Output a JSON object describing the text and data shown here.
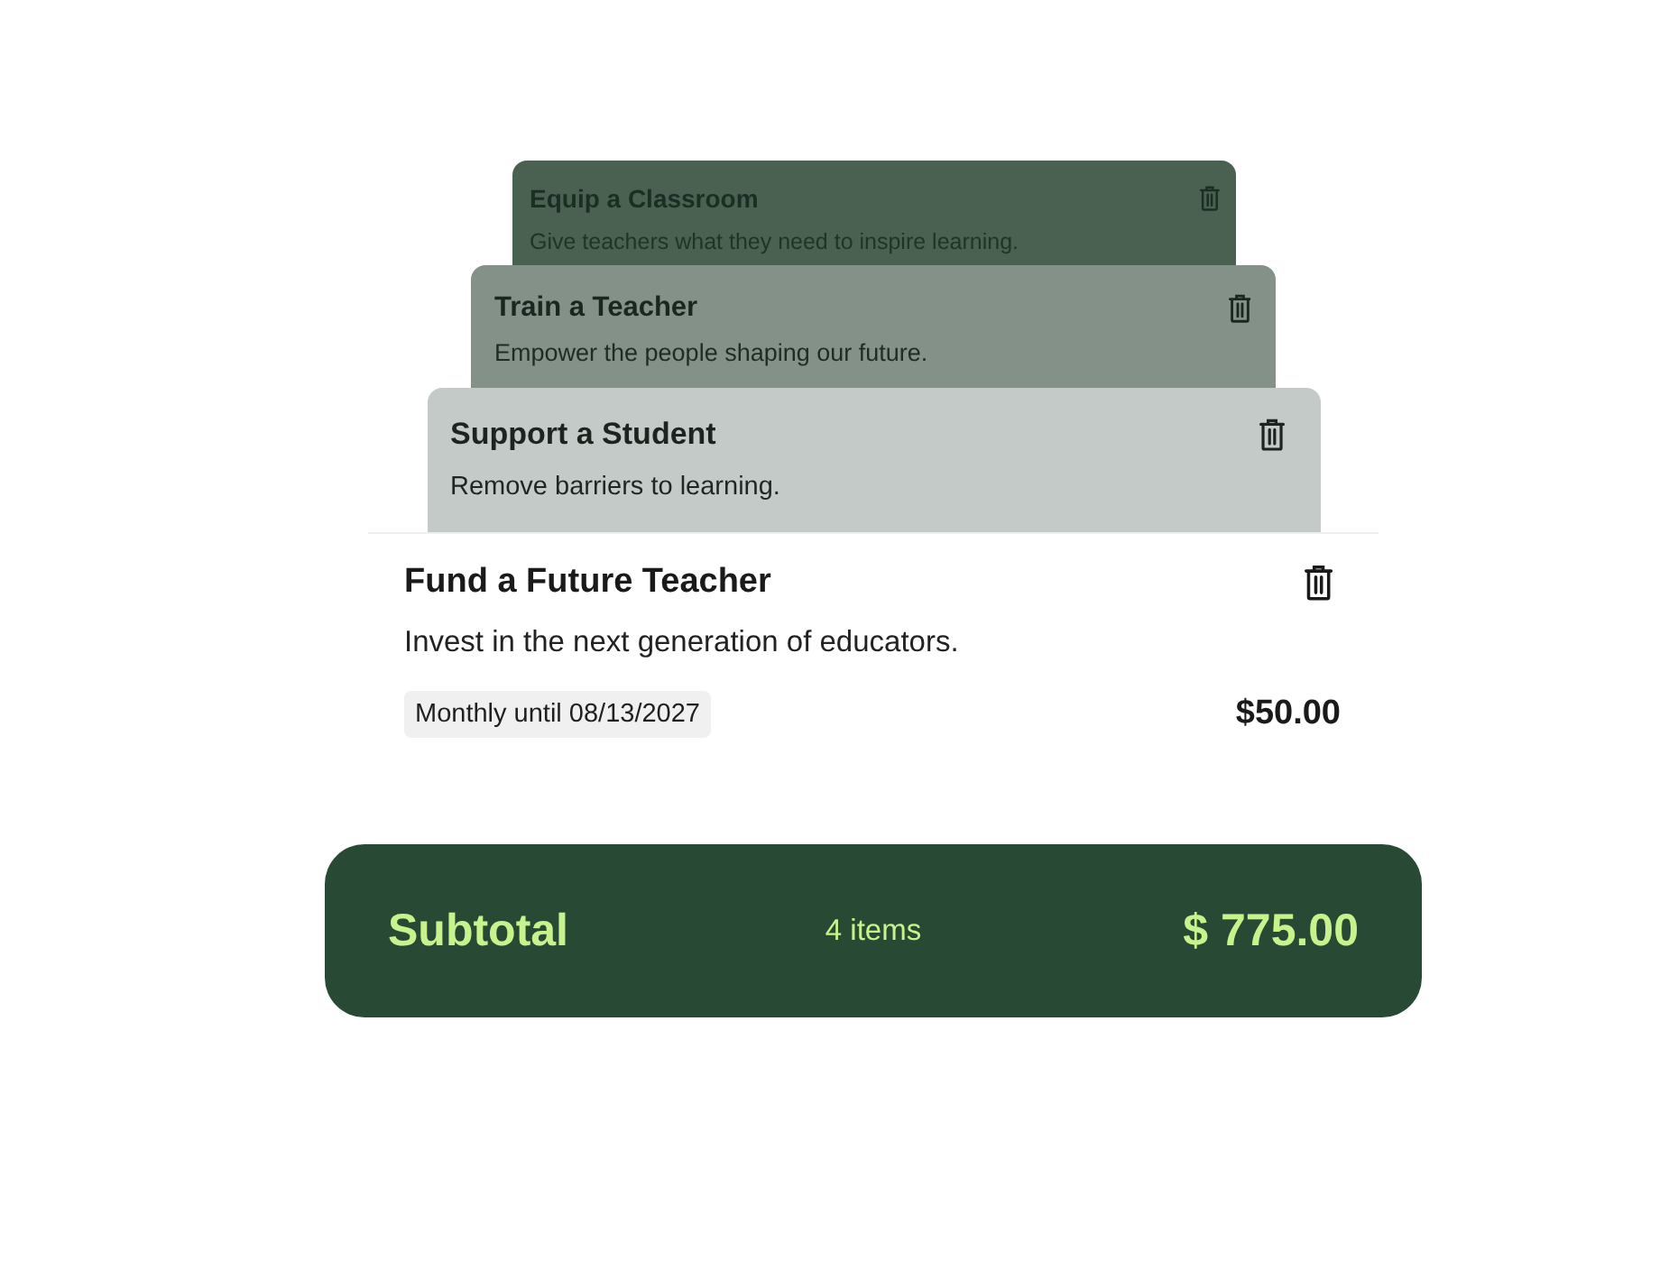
{
  "stacked_items": [
    {
      "title": "Equip a Classroom",
      "description": "Give teachers what they need to inspire learning."
    },
    {
      "title": "Train a Teacher",
      "description": "Empower the people shaping our future."
    },
    {
      "title": "Support a Student",
      "description": "Remove barriers to learning."
    }
  ],
  "item": {
    "title": "Fund a Future Teacher",
    "description": "Invest in the next generation of educators.",
    "schedule": "Monthly until 08/13/2027",
    "amount": "$50.00"
  },
  "subtotal": {
    "label": "Subtotal",
    "count": "4 items",
    "total": "$ 775.00"
  }
}
